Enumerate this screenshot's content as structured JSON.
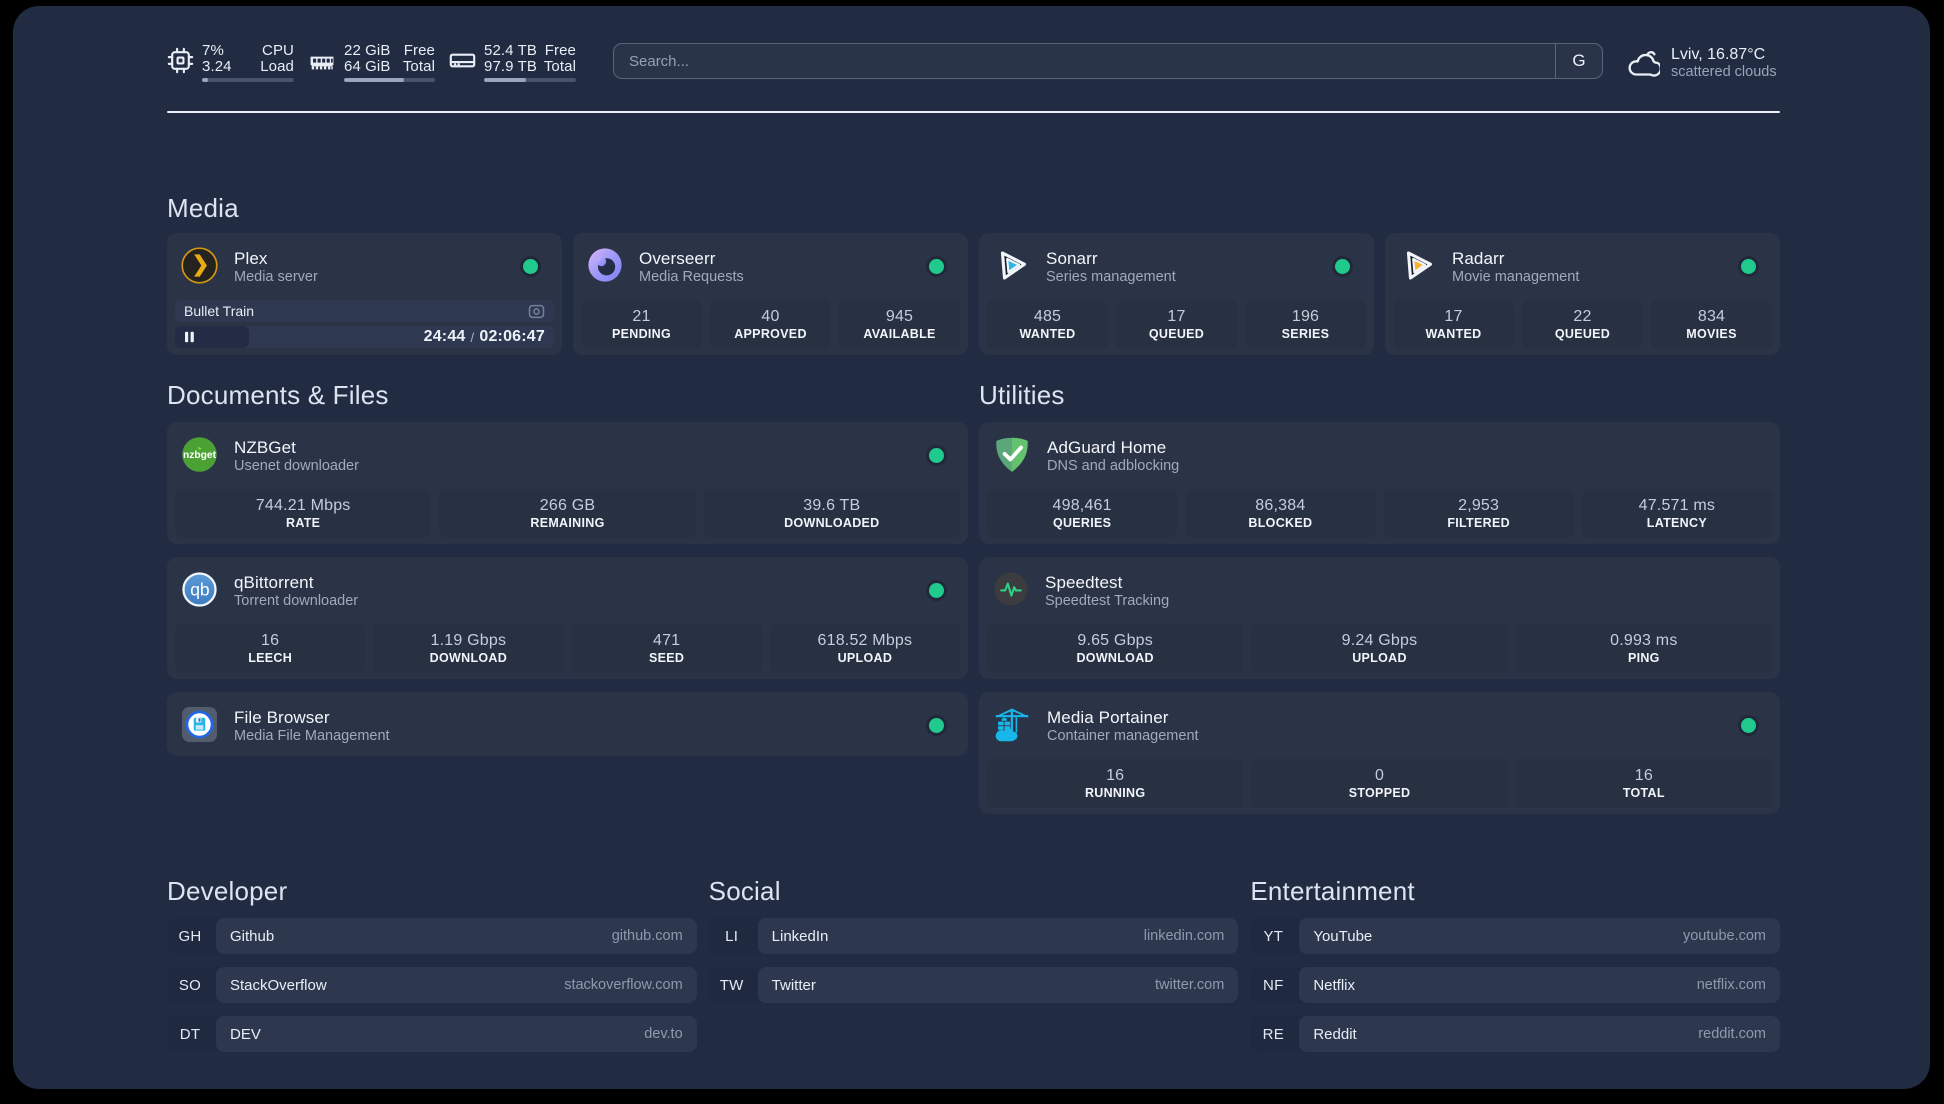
{
  "colors": {
    "background_outer": "#000000",
    "background_page": "#212b42",
    "card": "#2b3447",
    "stat_block": "#273142",
    "accent_green": "#20c98c",
    "divider": "#eef1f7"
  },
  "topbar": {
    "resources": [
      {
        "icon": "cpu-icon",
        "rows": [
          {
            "value": "7%",
            "label": "CPU"
          },
          {
            "value": "3.24",
            "label": "Load"
          }
        ],
        "progress_percent": 7
      },
      {
        "icon": "memory-icon",
        "rows": [
          {
            "value": "22 GiB",
            "label": "Free"
          },
          {
            "value": "64 GiB",
            "label": "Total"
          }
        ],
        "progress_percent": 66
      },
      {
        "icon": "hard-drive-icon",
        "rows": [
          {
            "value": "52.4 TB",
            "label": "Free"
          },
          {
            "value": "97.9 TB",
            "label": "Total"
          }
        ],
        "progress_percent": 46
      }
    ],
    "search": {
      "placeholder": "Search...",
      "provider_label": "G"
    },
    "weather": {
      "location": "Lviv, 16.87°C",
      "condition": "scattered clouds"
    }
  },
  "service_groups": [
    {
      "title": "Media",
      "services": [
        {
          "name": "Plex",
          "description": "Media server",
          "icon": "plex-icon",
          "status": "online",
          "player": {
            "title": "Bullet Train",
            "elapsed": "24:44",
            "separator": "/",
            "duration": "02:06:47",
            "progress_percent": 19.6
          }
        },
        {
          "name": "Overseerr",
          "description": "Media Requests",
          "icon": "overseerr-icon",
          "status": "online",
          "stats": [
            {
              "value": "21",
              "label": "PENDING"
            },
            {
              "value": "40",
              "label": "APPROVED"
            },
            {
              "value": "945",
              "label": "AVAILABLE"
            }
          ]
        },
        {
          "name": "Sonarr",
          "description": "Series management",
          "icon": "sonarr-icon",
          "status": "online",
          "stats": [
            {
              "value": "485",
              "label": "WANTED"
            },
            {
              "value": "17",
              "label": "QUEUED"
            },
            {
              "value": "196",
              "label": "SERIES"
            }
          ]
        },
        {
          "name": "Radarr",
          "description": "Movie management",
          "icon": "radarr-icon",
          "status": "online",
          "stats": [
            {
              "value": "17",
              "label": "WANTED"
            },
            {
              "value": "22",
              "label": "QUEUED"
            },
            {
              "value": "834",
              "label": "MOVIES"
            }
          ]
        }
      ]
    },
    {
      "title": "Documents & Files",
      "services": [
        {
          "name": "NZBGet",
          "description": "Usenet downloader",
          "icon": "nzbget-icon",
          "status": "online",
          "stats": [
            {
              "value": "744.21 Mbps",
              "label": "RATE"
            },
            {
              "value": "266 GB",
              "label": "REMAINING"
            },
            {
              "value": "39.6 TB",
              "label": "DOWNLOADED"
            }
          ]
        },
        {
          "name": "qBittorrent",
          "description": "Torrent downloader",
          "icon": "qbittorrent-icon",
          "status": "online",
          "stats": [
            {
              "value": "16",
              "label": "LEECH"
            },
            {
              "value": "1.19 Gbps",
              "label": "DOWNLOAD"
            },
            {
              "value": "471",
              "label": "SEED"
            },
            {
              "value": "618.52 Mbps",
              "label": "UPLOAD"
            }
          ]
        },
        {
          "name": "File Browser",
          "description": "Media File Management",
          "icon": "filebrowser-icon",
          "status": "online"
        }
      ]
    },
    {
      "title": "Utilities",
      "services": [
        {
          "name": "AdGuard Home",
          "description": "DNS and adblocking",
          "icon": "adguard-icon",
          "stats": [
            {
              "value": "498,461",
              "label": "QUERIES"
            },
            {
              "value": "86,384",
              "label": "BLOCKED"
            },
            {
              "value": "2,953",
              "label": "FILTERED"
            },
            {
              "value": "47.571 ms",
              "label": "LATENCY"
            }
          ]
        },
        {
          "name": "Speedtest",
          "description": "Speedtest Tracking",
          "icon": "speedtest-icon",
          "stats": [
            {
              "value": "9.65 Gbps",
              "label": "DOWNLOAD"
            },
            {
              "value": "9.24 Gbps",
              "label": "UPLOAD"
            },
            {
              "value": "0.993 ms",
              "label": "PING"
            }
          ]
        },
        {
          "name": "Media Portainer",
          "description": "Container management",
          "icon": "portainer-icon",
          "status": "online",
          "stats": [
            {
              "value": "16",
              "label": "RUNNING"
            },
            {
              "value": "0",
              "label": "STOPPED"
            },
            {
              "value": "16",
              "label": "TOTAL"
            }
          ]
        }
      ]
    }
  ],
  "bookmark_groups": [
    {
      "title": "Developer",
      "bookmarks": [
        {
          "abbr": "GH",
          "name": "Github",
          "url": "github.com"
        },
        {
          "abbr": "SO",
          "name": "StackOverflow",
          "url": "stackoverflow.com"
        },
        {
          "abbr": "DT",
          "name": "DEV",
          "url": "dev.to"
        }
      ]
    },
    {
      "title": "Social",
      "bookmarks": [
        {
          "abbr": "LI",
          "name": "LinkedIn",
          "url": "linkedin.com"
        },
        {
          "abbr": "TW",
          "name": "Twitter",
          "url": "twitter.com"
        }
      ]
    },
    {
      "title": "Entertainment",
      "bookmarks": [
        {
          "abbr": "YT",
          "name": "YouTube",
          "url": "youtube.com"
        },
        {
          "abbr": "NF",
          "name": "Netflix",
          "url": "netflix.com"
        },
        {
          "abbr": "RE",
          "name": "Reddit",
          "url": "reddit.com"
        }
      ]
    }
  ]
}
